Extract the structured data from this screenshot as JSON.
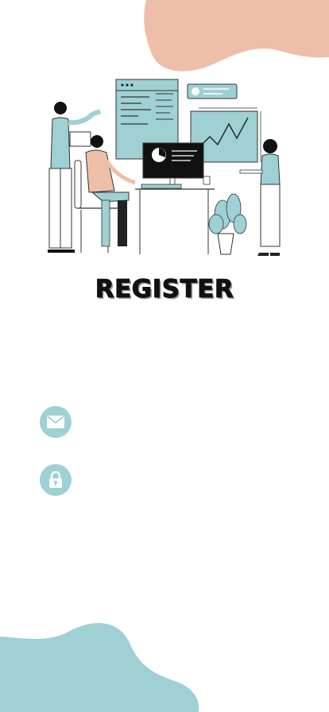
{
  "screen": {
    "title": "REGISTER"
  },
  "form": {
    "email": {
      "value": "",
      "placeholder": "",
      "icon": "envelope-icon"
    },
    "password": {
      "value": "",
      "placeholder": "",
      "icon": "lock-icon"
    }
  },
  "colors": {
    "accent_teal": "#9fd0d3",
    "accent_peach": "#eebfa8",
    "title_text": "#111111"
  }
}
